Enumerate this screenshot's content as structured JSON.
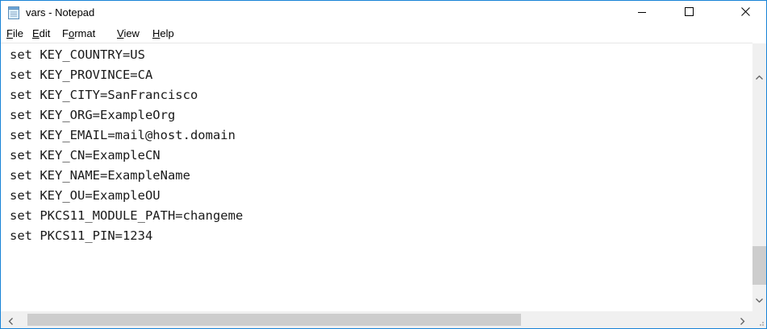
{
  "window": {
    "title": "vars - Notepad",
    "accent_border": "#1883d7",
    "controls": [
      "minimize-icon",
      "maximize-icon",
      "close-icon"
    ]
  },
  "menu": {
    "file": {
      "mnemonic": "F",
      "rest": "ile"
    },
    "edit": {
      "mnemonic": "E",
      "rest": "dit"
    },
    "format": {
      "pre": "F",
      "mnemonic": "o",
      "rest": "rmat"
    },
    "view": {
      "mnemonic": "V",
      "rest": "iew"
    },
    "help": {
      "mnemonic": "H",
      "rest": "elp"
    }
  },
  "editor": {
    "lines": [
      "set KEY_COUNTRY=US",
      "set KEY_PROVINCE=CA",
      "set KEY_CITY=SanFrancisco",
      "set KEY_ORG=ExampleOrg",
      "set KEY_EMAIL=mail@host.domain",
      "set KEY_CN=ExampleCN",
      "set KEY_NAME=ExampleName",
      "set KEY_OU=ExampleOU",
      "set PKCS11_MODULE_PATH=changeme",
      "set PKCS11_PIN=1234"
    ]
  },
  "scrollbars": {
    "icons": [
      "chevron-up-icon",
      "chevron-down-icon",
      "chevron-left-icon",
      "chevron-right-icon"
    ]
  }
}
